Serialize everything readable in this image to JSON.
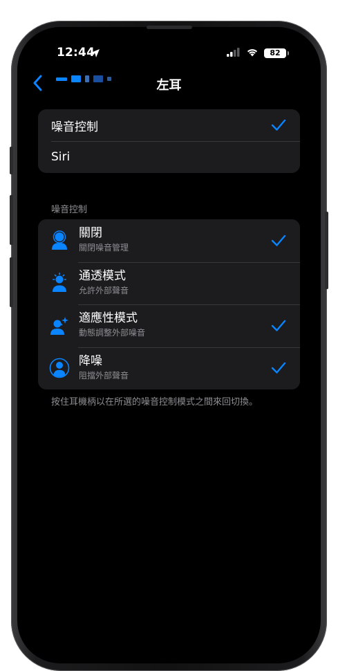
{
  "status_bar": {
    "time": "12:44",
    "battery": "82"
  },
  "nav": {
    "title": "左耳",
    "back_label_blurred": ""
  },
  "top_group": {
    "items": [
      {
        "label": "噪音控制",
        "checked": true
      },
      {
        "label": "Siri",
        "checked": false
      }
    ]
  },
  "noise_section": {
    "header": "噪音控制",
    "modes": [
      {
        "title": "關閉",
        "subtitle": "關閉噪音管理",
        "icon": "person-off-icon",
        "checked": true
      },
      {
        "title": "通透模式",
        "subtitle": "允許外部聲音",
        "icon": "person-transparency-icon",
        "checked": false
      },
      {
        "title": "適應性模式",
        "subtitle": "動態調整外部噪音",
        "icon": "person-adaptive-icon",
        "checked": true
      },
      {
        "title": "降噪",
        "subtitle": "阻擋外部聲音",
        "icon": "person-noise-cancel-icon",
        "checked": true
      }
    ],
    "footer": "按住耳機柄以在所選的噪音控制模式之間來回切換。"
  },
  "colors": {
    "accent": "#0a84ff",
    "background": "#000000",
    "cell": "#1c1c1e",
    "secondary_text": "#8e8e93"
  }
}
